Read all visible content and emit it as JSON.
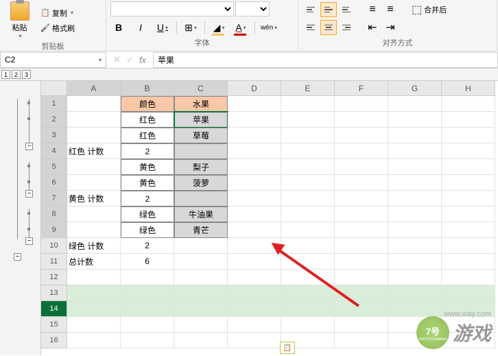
{
  "ribbon": {
    "clipboard": {
      "paste": "粘贴",
      "copy": "复制",
      "format_painter": "格式刷",
      "label": "剪贴板"
    },
    "font": {
      "label": "字体",
      "wen_label": "wén"
    },
    "alignment": {
      "label": "对齐方式",
      "merge": "合并后"
    }
  },
  "namebox": {
    "cell_ref": "C2"
  },
  "formula_bar": {
    "fx": "fx",
    "value": "苹果"
  },
  "outline": {
    "levels": [
      "1",
      "2",
      "3"
    ]
  },
  "columns": [
    "A",
    "B",
    "C",
    "D",
    "E",
    "F",
    "G",
    "H"
  ],
  "rows_data": [
    {
      "n": "1",
      "a": "",
      "b": "颜色",
      "c": "水果",
      "header": true
    },
    {
      "n": "2",
      "a": "",
      "b": "红色",
      "c": "苹果"
    },
    {
      "n": "3",
      "a": "",
      "b": "红色",
      "c": "草莓"
    },
    {
      "n": "4",
      "a": "红色 计数",
      "b": "2",
      "c": ""
    },
    {
      "n": "5",
      "a": "",
      "b": "黄色",
      "c": "梨子"
    },
    {
      "n": "6",
      "a": "",
      "b": "黄色",
      "c": "菠萝"
    },
    {
      "n": "7",
      "a": "黄色 计数",
      "b": "2",
      "c": ""
    },
    {
      "n": "8",
      "a": "",
      "b": "绿色",
      "c": "牛油果"
    },
    {
      "n": "9",
      "a": "",
      "b": "绿色",
      "c": "青芒"
    },
    {
      "n": "10",
      "a": "绿色 计数",
      "b": "2",
      "c": ""
    },
    {
      "n": "11",
      "a": "总计数",
      "b": "6",
      "c": ""
    },
    {
      "n": "12",
      "a": "",
      "b": "",
      "c": ""
    },
    {
      "n": "13",
      "a": "",
      "b": "",
      "c": ""
    },
    {
      "n": "14",
      "a": "",
      "b": "",
      "c": ""
    },
    {
      "n": "15",
      "a": "",
      "b": "",
      "c": ""
    },
    {
      "n": "16",
      "a": "",
      "b": "",
      "c": ""
    }
  ],
  "watermark": {
    "circle_top": "7号",
    "circle_bottom": "JIAOYOUXIWANG",
    "text": "游戏",
    "url": "www.xiay.com"
  }
}
